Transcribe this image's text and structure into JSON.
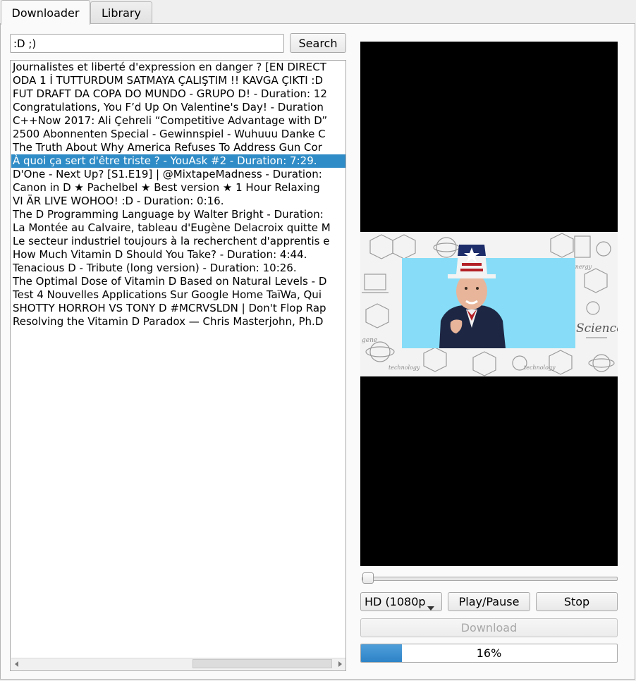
{
  "tabs": [
    {
      "label": "Downloader",
      "active": true
    },
    {
      "label": "Library",
      "active": false
    }
  ],
  "search": {
    "value": ":D ;)",
    "button_label": "Search"
  },
  "results": [
    "Journalistes et liberté d'expression en danger ? [EN DIRECT",
    "ODA 1 İ TUTTURDUM SATMAYA ÇALIŞTIM !! KAVGA ÇIKTI :D",
    "FUT DRAFT DA COPA DO MUNDO - GRUPO D! - Duration: 12",
    "Congratulations, You F’d Up On Valentine's Day! - Duration",
    "C++Now 2017: Ali Çehreli “Competitive Advantage with D”",
    "2500 Abonnenten Special - Gewinnspiel - Wuhuuu Danke C",
    "The Truth About Why America Refuses To Address Gun Cor",
    "À quoi ça sert d'être triste ? - YouAsk #2 - Duration: 7:29.",
    "D'One - Next Up? [S1.E19] | @MixtapeMadness - Duration:",
    "Canon in D ★ Pachelbel ★ Best version ★ 1 Hour Relaxing",
    "VI ÄR LIVE WOHOO! :D - Duration: 0:16.",
    "The D Programming Language by Walter Bright - Duration:",
    "La Montée au Calvaire, tableau d'Eugène Delacroix quitte M",
    "Le secteur industriel toujours à la recherchent d'apprentis e",
    "How Much Vitamin D Should You Take? - Duration: 4:44.",
    "Tenacious D - Tribute (long version) - Duration: 10:26.",
    "The Optimal Dose of Vitamin D Based on Natural Levels - D",
    "Test 4 Nouvelles Applications Sur Google Home TaïWa, Qui",
    "SHOTTY HORROH VS TONY D #MCRVSLDN | Don't Flop Rap",
    "Resolving the Vitamin D Paradox — Chris Masterjohn, Ph.D"
  ],
  "selected_index": 7,
  "player": {
    "position": 0,
    "quality_value": "HD (1080p)",
    "play_pause_label": "Play/Pause",
    "stop_label": "Stop",
    "download_label": "Download",
    "progress_value": 0.16,
    "progress_text": "16%"
  },
  "colors": {
    "selection": "#308cc6",
    "progress_fill": "#3a8fd1",
    "thumb_background": "#87ddf7"
  }
}
